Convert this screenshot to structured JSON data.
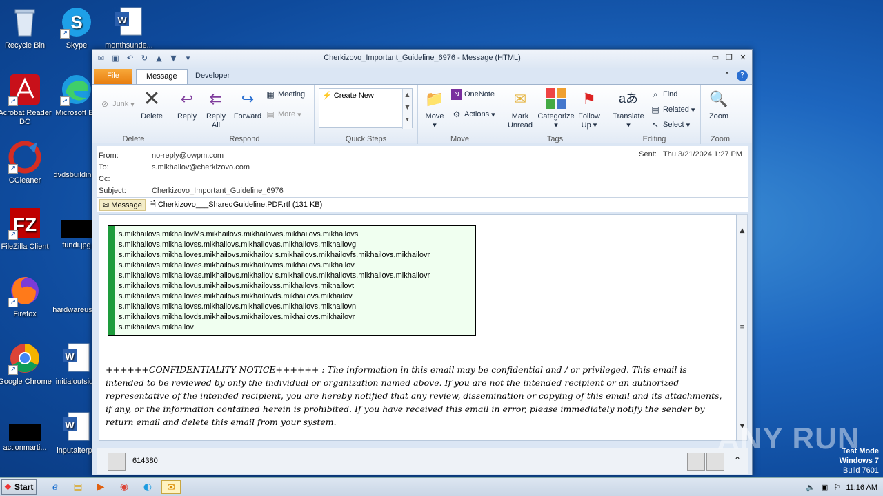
{
  "desktop": {
    "icons": [
      {
        "label": "Recycle Bin",
        "icon": "recycle-bin-icon"
      },
      {
        "label": "Skype",
        "icon": "skype-icon"
      },
      {
        "label": "monthsunde...",
        "icon": "word-doc-icon"
      },
      {
        "label": "Acrobat Reader DC",
        "icon": "acrobat-icon"
      },
      {
        "label": "Microsoft Ed",
        "icon": "edge-icon"
      },
      {
        "label": "CCleaner",
        "icon": "ccleaner-icon"
      },
      {
        "label": "dvdsbuildin",
        "icon": "blank-file-icon"
      },
      {
        "label": "FileZilla Client",
        "icon": "filezilla-icon"
      },
      {
        "label": "fundi.jpg",
        "icon": "image-file-icon"
      },
      {
        "label": "Firefox",
        "icon": "firefox-icon"
      },
      {
        "label": "hardwareus",
        "icon": "blank-file-icon"
      },
      {
        "label": "Google Chrome",
        "icon": "chrome-icon"
      },
      {
        "label": "initialoutside",
        "icon": "word-doc-icon"
      },
      {
        "label": "actionmarti...",
        "icon": "image-file-icon"
      },
      {
        "label": "inputalterpa",
        "icon": "word-doc-icon"
      }
    ]
  },
  "window": {
    "title": "Cherkizovo_Important_Guideline_6976 - Message (HTML)",
    "tabs": {
      "file": "File",
      "message": "Message",
      "developer": "Developer"
    }
  },
  "ribbon": {
    "delete": {
      "label": "Delete",
      "junk": "Junk",
      "delete_btn": "Delete"
    },
    "respond": {
      "label": "Respond",
      "reply": "Reply",
      "reply_all_1": "Reply",
      "reply_all_2": "All",
      "forward": "Forward",
      "meeting": "Meeting",
      "more": "More"
    },
    "quick_steps": {
      "label": "Quick Steps",
      "create_new": "Create New"
    },
    "move": {
      "label": "Move",
      "move_btn": "Move",
      "onenote": "OneNote",
      "actions": "Actions"
    },
    "tags": {
      "label": "Tags",
      "mark_1": "Mark",
      "mark_2": "Unread",
      "categorize": "Categorize",
      "follow_1": "Follow",
      "follow_2": "Up"
    },
    "editing": {
      "label": "Editing",
      "translate": "Translate",
      "find": "Find",
      "related": "Related",
      "select": "Select"
    },
    "zoom": {
      "label": "Zoom",
      "zoom_btn": "Zoom"
    }
  },
  "header": {
    "from_label": "From:",
    "from": "no-reply@owpm.com",
    "to_label": "To:",
    "to": "s.mikhailov@cherkizovo.com",
    "cc_label": "Cc:",
    "subject_label": "Subject:",
    "subject": "Cherkizovo_Important_Guideline_6976",
    "sent_label": "Sent:",
    "sent": "Thu 3/21/2024 1:27 PM"
  },
  "attachments": {
    "message_tab": "Message",
    "file": "Cherkizovo___SharedGuideline.PDF.rtf (131 KB)"
  },
  "body": {
    "lines": [
      "s.mikhailovs.mikhailovMs.mikhailovs.mikhailoves.mikhailovs.mikhailovs",
      "s.mikhailovs.mikhailovss.mikhailovs.mikhailovas.mikhailovs.mikhailovg",
      "s.mikhailovs.mikhailoves.mikhailovs.mikhailov s.mikhailovs.mikhailovfs.mikhailovs.mikhailovr",
      "s.mikhailovs.mikhailoves.mikhailovs.mikhailovms.mikhailovs.mikhailov",
      "s.mikhailovs.mikhailovas.mikhailovs.mikhailov s.mikhailovs.mikhailovts.mikhailovs.mikhailovr",
      "s.mikhailovs.mikhailovus.mikhailovs.mikhailovss.mikhailovs.mikhailovt",
      "s.mikhailovs.mikhailoves.mikhailovs.mikhailovds.mikhailovs.mikhailov",
      "s.mikhailovs.mikhailovss.mikhailovs.mikhailoves.mikhailovs.mikhailovn",
      "s.mikhailovs.mikhailovds.mikhailovs.mikhailoves.mikhailovs.mikhailovr",
      "s.mikhailovs.mikhailov"
    ],
    "notice": "++++++CONFIDENTIALITY NOTICE++++++ : The information in this email may be confidential and / or privileged. This email is intended to be reviewed by only the individual or organization named above. If you are not the intended recipient or an authorized representative of the intended recipient, you are hereby notified that any review, dissemination or copying of this email and its attachments, if any, or the information contained herein is prohibited. If you have received this email in error, please immediately notify the sender by return email and delete this email from your system."
  },
  "people_pane": {
    "name": "614380"
  },
  "taskbar": {
    "start": "Start",
    "time": "11:16 AM"
  },
  "watermark": {
    "line1": "Test Mode",
    "line2": "Windows 7",
    "line3": "Build 7601",
    "brand": "ANY RUN"
  },
  "colors": {
    "accent_green": "#1e9c3c",
    "file_tab": "#e87e10",
    "desktop": "#1d66bf"
  }
}
